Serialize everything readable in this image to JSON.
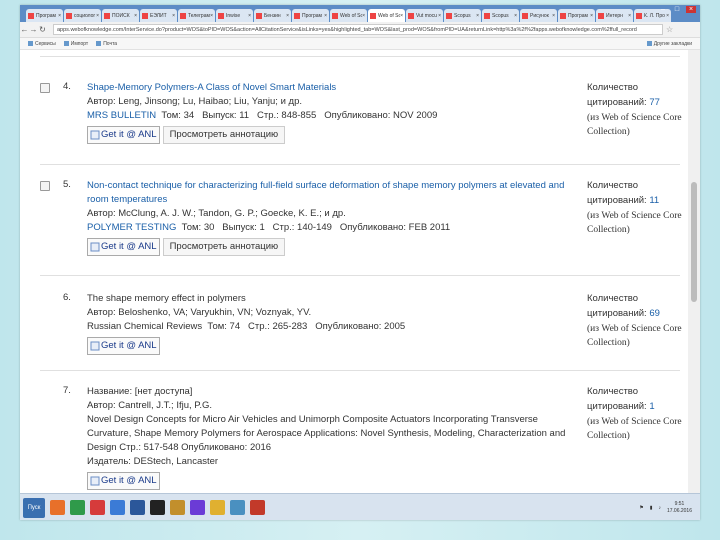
{
  "browser": {
    "tabs": [
      {
        "label": "Програм",
        "active": false
      },
      {
        "label": "социолог",
        "active": false
      },
      {
        "label": "ПОИСК",
        "active": false
      },
      {
        "label": "ЕЭЛИТ",
        "active": false
      },
      {
        "label": "Телеграм",
        "active": false
      },
      {
        "label": "Inwise",
        "active": false
      },
      {
        "label": "Бензин",
        "active": false
      },
      {
        "label": "Програм",
        "active": false
      },
      {
        "label": "Web of Sc",
        "active": false
      },
      {
        "label": "Web of Sc",
        "active": true
      },
      {
        "label": "Vut mocu",
        "active": false
      },
      {
        "label": "Scopus",
        "active": false
      },
      {
        "label": "Scopus",
        "active": false
      },
      {
        "label": "Рисунок",
        "active": false
      },
      {
        "label": "Програм",
        "active": false
      },
      {
        "label": "Интерн",
        "active": false
      },
      {
        "label": "К. Л. Про",
        "active": false
      }
    ],
    "url": "apps.webofknowledge.com/InterService.do?product=WOS&toPID=WOS&action=AllCitationService&isLinks=yes&highlighted_tab=WOS&last_prod=WOS&fromPID=UA&returnLink=http%3a%2f%2fapps.webofknowledge.com%2ffull_record",
    "bookmarks": [
      "Сервисы",
      "Импорт",
      "Почта"
    ],
    "bookmarks_right": "Другие закладки"
  },
  "records": [
    {
      "num": "4.",
      "title": "Shape-Memory Polymers-A Class of Novel Smart Materials",
      "title_link": true,
      "author": "Автор: Leng, Jinsong; Lu, Haibao; Liu, Yanju; и др.",
      "source": "MRS BULLETIN",
      "source_meta": "  Том: 34   Выпуск: 11   Стр.: 848-855   Опубликовано: NOV 2009",
      "getit": "Get it @ ANL",
      "annot": "Просмотреть аннотацию",
      "cite_label1": "Количество",
      "cite_label2": "цитирований: ",
      "cite_count": "77",
      "cite_src1": "(из Web of Science Core",
      "cite_src2": "Collection)"
    },
    {
      "num": "5.",
      "title": "Non-contact technique for characterizing full-field surface deformation of shape memory polymers at elevated and room temperatures",
      "title_link": true,
      "author": "Автор: McClung, A. J. W.; Tandon, G. P.; Goecke, K. E.; и др.",
      "source": "POLYMER TESTING",
      "source_meta": "  Том: 30   Выпуск: 1   Стр.: 140-149   Опубликовано: FEB 2011",
      "getit": "Get it @ ANL",
      "annot": "Просмотреть аннотацию",
      "cite_label1": "Количество",
      "cite_label2": "цитирований: ",
      "cite_count": "11",
      "cite_src1": "(из Web of Science Core",
      "cite_src2": "Collection)"
    },
    {
      "num": "6.",
      "title": "The shape memory effect in polymers",
      "title_link": false,
      "author": "Автор: Beloshenko, VA; Varyukhin, VN; Voznyak, YV.",
      "source": "Russian Chemical Reviews",
      "source_meta": "  Том: 74   Стр.: 265-283   Опубликовано: 2005",
      "getit": "Get it @ ANL",
      "cite_label1": "Количество",
      "cite_label2": "цитирований: ",
      "cite_count": "69",
      "cite_src1": "(из Web of Science Core",
      "cite_src2": "Collection)"
    },
    {
      "num": "7.",
      "title": "Название: [нет доступа]",
      "title_link": false,
      "author": "Автор: Cantrell, J.T.; Ifju, P.G.",
      "extra": "Novel Design Concepts for Micro Air Vehicles and Unimorph Composite Actuators Incorporating Transverse Curvature, Shape Memory Polymers for Aerospace Applications: Novel Synthesis, Modeling, Characterization and Design  Стр.: 517-548   Опубликовано: 2016",
      "publisher": "Издатель: DEStech, Lancaster",
      "getit": "Get it @ ANL",
      "cite_label1": "Количество",
      "cite_label2": "цитирований: ",
      "cite_count": "1",
      "cite_src1": "(из Web of Science Core",
      "cite_src2": "Collection)"
    }
  ],
  "taskbar": {
    "start": "Пуск",
    "icons": [
      "firefox-icon",
      "chrome-icon",
      "opera-icon",
      "explorer-icon",
      "word-icon",
      "cmd-icon",
      "paint-icon",
      "media-icon",
      "folder-icon",
      "search-icon",
      "pdf-icon"
    ],
    "clock_time": "9:51",
    "clock_date": "17.06.2016"
  },
  "colors": {
    "link": "#1a5fa8",
    "tabbar": "#5c8cc6"
  }
}
